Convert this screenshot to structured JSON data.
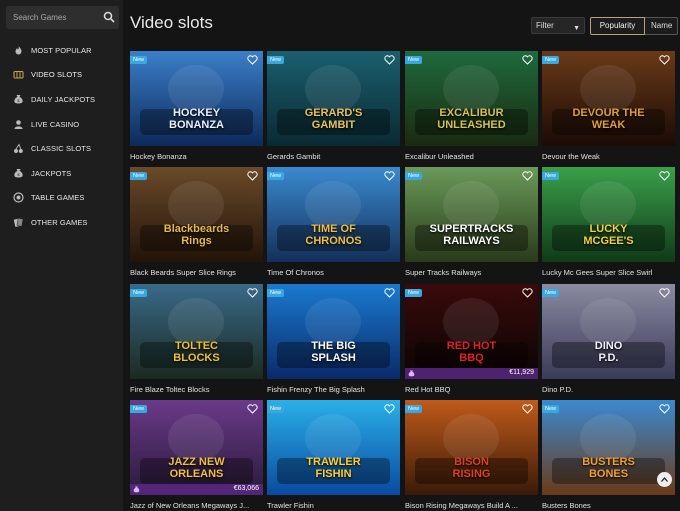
{
  "search": {
    "placeholder": "Search Games"
  },
  "nav": [
    {
      "label": "MOST POPULAR",
      "icon": "flame-icon",
      "active": false
    },
    {
      "label": "VIDEO SLOTS",
      "icon": "video-slots-icon",
      "active": true
    },
    {
      "label": "DAILY JACKPOTS",
      "icon": "money-bag-icon",
      "active": false
    },
    {
      "label": "LIVE CASINO",
      "icon": "dealer-icon",
      "active": false
    },
    {
      "label": "CLASSIC SLOTS",
      "icon": "cherries-icon",
      "active": false
    },
    {
      "label": "JACKPOTS",
      "icon": "jackpot-bag-icon",
      "active": false
    },
    {
      "label": "TABLE GAMES",
      "icon": "chip-icon",
      "active": false
    },
    {
      "label": "OTHER GAMES",
      "icon": "cards-icon",
      "active": false
    }
  ],
  "header": {
    "title": "Video slots",
    "filter_label": "Filter",
    "sort_popularity": "Popularity",
    "sort_name": "Name"
  },
  "badge_label": "New",
  "games": [
    {
      "name": "Hockey Bonanza",
      "logo": "HOCKEY BONANZA",
      "bg1": "#3b7fc9",
      "bg2": "#0d2a5a",
      "logoColor": "#e9f1ff"
    },
    {
      "name": "Gerards Gambit",
      "logo": "GERARD'S GAMBIT",
      "bg1": "#1b5f6e",
      "bg2": "#0a2a33",
      "logoColor": "#e8c15a"
    },
    {
      "name": "Excalibur Unleashed",
      "logo": "EXCALIBUR UNLEASHED",
      "bg1": "#1f6a3e",
      "bg2": "#1a2a10",
      "logoColor": "#d6c05a"
    },
    {
      "name": "Devour the Weak",
      "logo": "DEVOUR THE WEAK",
      "bg1": "#6a3a18",
      "bg2": "#1a0a05",
      "logoColor": "#e0a030"
    },
    {
      "name": "Black Beards Super Slice Rings",
      "logo": "Blackbeards Rings",
      "bg1": "#6a4a2a",
      "bg2": "#221408",
      "logoColor": "#e6b94a"
    },
    {
      "name": "Time Of Chronos",
      "logo": "TIME OF CHRONOS",
      "bg1": "#3a8ad0",
      "bg2": "#14305a",
      "logoColor": "#f0c040"
    },
    {
      "name": "Super Tracks Railways",
      "logo": "SUPERTRACKS RAILWAYS",
      "bg1": "#6a9a5a",
      "bg2": "#2a3a1a",
      "logoColor": "#ffffff"
    },
    {
      "name": "Lucky Mc Gees Super Slice Swirl",
      "logo": "LUCKY MCGEE'S",
      "bg1": "#3aa04a",
      "bg2": "#103a18",
      "logoColor": "#f0d040"
    },
    {
      "name": "Fire Blaze Toltec Blocks",
      "logo": "TOLTEC BLOCKS",
      "bg1": "#3a6a8a",
      "bg2": "#1a2a20",
      "logoColor": "#f0c030"
    },
    {
      "name": "Fishin Frenzy The Big Splash",
      "logo": "THE BIG SPLASH",
      "bg1": "#1a7ad0",
      "bg2": "#0a2a6a",
      "logoColor": "#ffffff"
    },
    {
      "name": "Red Hot BBQ",
      "logo": "RED HOT BBQ",
      "bg1": "#3a0a0a",
      "bg2": "#0a0505",
      "logoColor": "#e0202a",
      "jackpot": "€11,929"
    },
    {
      "name": "Dino P.D.",
      "logo": "DINO P.D.",
      "bg1": "#8a8aa0",
      "bg2": "#3a3a5a",
      "logoColor": "#f0f0ff"
    },
    {
      "name": "Jazz of New Orleans Megaways J...",
      "logo": "JAZZ NEW ORLEANS",
      "bg1": "#6a3a8a",
      "bg2": "#2a1a3a",
      "logoColor": "#f0c040",
      "jackpot": "€63,066"
    },
    {
      "name": "Trawler Fishin",
      "logo": "TRAWLER FISHIN",
      "bg1": "#2ab0e8",
      "bg2": "#0a4aa0",
      "logoColor": "#ffd030"
    },
    {
      "name": "Bison Rising Megaways Build A ...",
      "logo": "BISON RISING",
      "bg1": "#c05a1a",
      "bg2": "#3a1a08",
      "logoColor": "#e04020"
    },
    {
      "name": "Busters Bones",
      "logo": "BUSTERS BONES",
      "bg1": "#3a8ad0",
      "bg2": "#6a3a18",
      "logoColor": "#f0a030"
    }
  ]
}
